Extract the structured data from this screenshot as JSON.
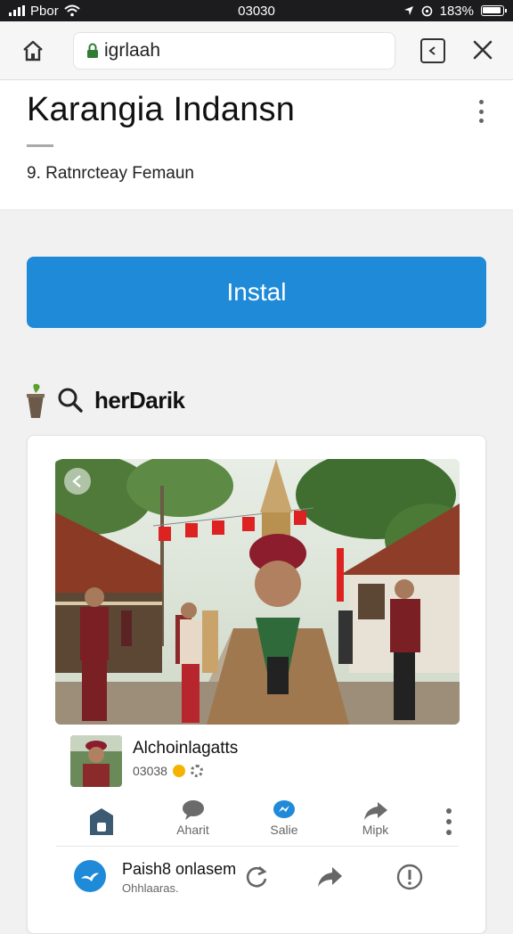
{
  "status_bar": {
    "carrier": "Pbor",
    "time": "03030",
    "battery": "183%"
  },
  "browser": {
    "url": "igrlaah"
  },
  "app": {
    "title": "Karangia Indansn",
    "developer": "9. Ratnrcteay Femaun",
    "install_label": "Instal"
  },
  "section": {
    "title": "herDarik"
  },
  "post": {
    "name": "Alchoinlagatts",
    "meta": "03038",
    "actions": [
      {
        "label": "Aharit",
        "icon": "comment-icon"
      },
      {
        "label": "Salie",
        "icon": "messenger-icon"
      },
      {
        "label": "Mipk",
        "icon": "share-icon"
      }
    ]
  },
  "share_row": {
    "title": "Paish8 onlasem",
    "subtitle": "Ohhlaaras."
  },
  "colors": {
    "accent": "#1e8ad8",
    "status_bar": "#1c1c1e"
  }
}
